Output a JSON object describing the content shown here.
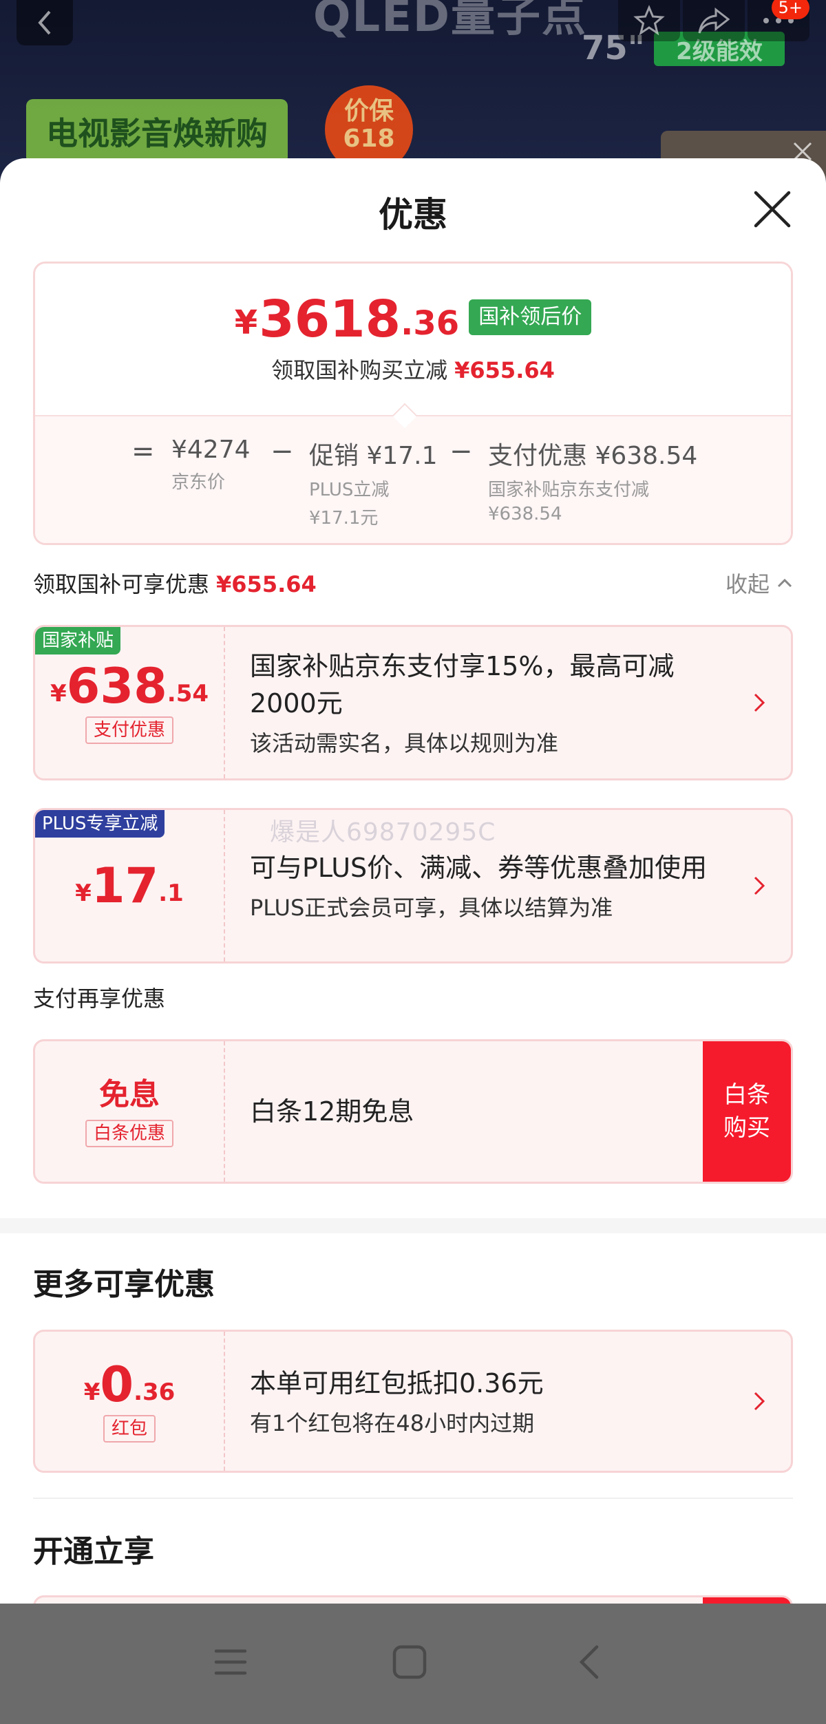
{
  "background": {
    "headline": "QLED量子点",
    "screen_size": "75\"",
    "energy_label": "2级能效",
    "banner": "电视影音焕新购",
    "guarantee_line1": "价保",
    "guarantee_line2": "618",
    "notification_badge": "5+"
  },
  "sheet": {
    "title": "优惠"
  },
  "summary": {
    "currency": "¥",
    "price_integer": "3618",
    "price_decimal": ".36",
    "price_tag": "国补领后价",
    "subsidy_label": "领取国补购买立减",
    "subsidy_amount": "¥655.64",
    "breakdown": {
      "equals": "=",
      "minus": "−",
      "jd_price": "¥4274",
      "jd_price_label": "京东价",
      "promo": "促销 ¥17.1",
      "promo_note1": "PLUS立减",
      "promo_note2": "¥17.1元",
      "pay": "支付优惠 ¥638.54",
      "pay_note1": "国家补贴京东支付减",
      "pay_note2": "¥638.54"
    }
  },
  "gov_section": {
    "label": "领取国补可享优惠",
    "amount": "¥655.64",
    "collapse": "收起"
  },
  "coupons": [
    {
      "flag": "国家补贴",
      "flag_color": "#34a853",
      "currency": "¥",
      "int": "638",
      "dec": ".54",
      "type": "支付优惠",
      "title": "国家补贴京东支付享15%，最高可减2000元",
      "sub": "该活动需实名，具体以规则为准"
    },
    {
      "flag": "PLUS专享立减",
      "flag_color": "#2f3f9e",
      "currency": "¥",
      "int": "17",
      "dec": ".1",
      "title": "可与PLUS价、满减、券等优惠叠加使用",
      "sub": "PLUS正式会员可享，具体以结算为准"
    }
  ],
  "pay_section": {
    "label": "支付再享优惠",
    "card": {
      "main": "免息",
      "type": "白条优惠",
      "title": "白条12期免息",
      "buy_line1": "白条",
      "buy_line2": "购买"
    }
  },
  "more_section": {
    "title": "更多可享优惠",
    "card": {
      "currency": "¥",
      "int": "0",
      "dec": ".36",
      "type": "红包",
      "title": "本单可用红包抵扣0.36元",
      "sub": "有1个红包将在48小时内过期"
    }
  },
  "open_section": {
    "title": "开通立享"
  },
  "watermark": "爆是人69870295C",
  "colors": {
    "accent_red": "#e4232f",
    "gov_green": "#34a853",
    "plus_blue": "#2f3f9e",
    "buy_red": "#f51b2c"
  }
}
